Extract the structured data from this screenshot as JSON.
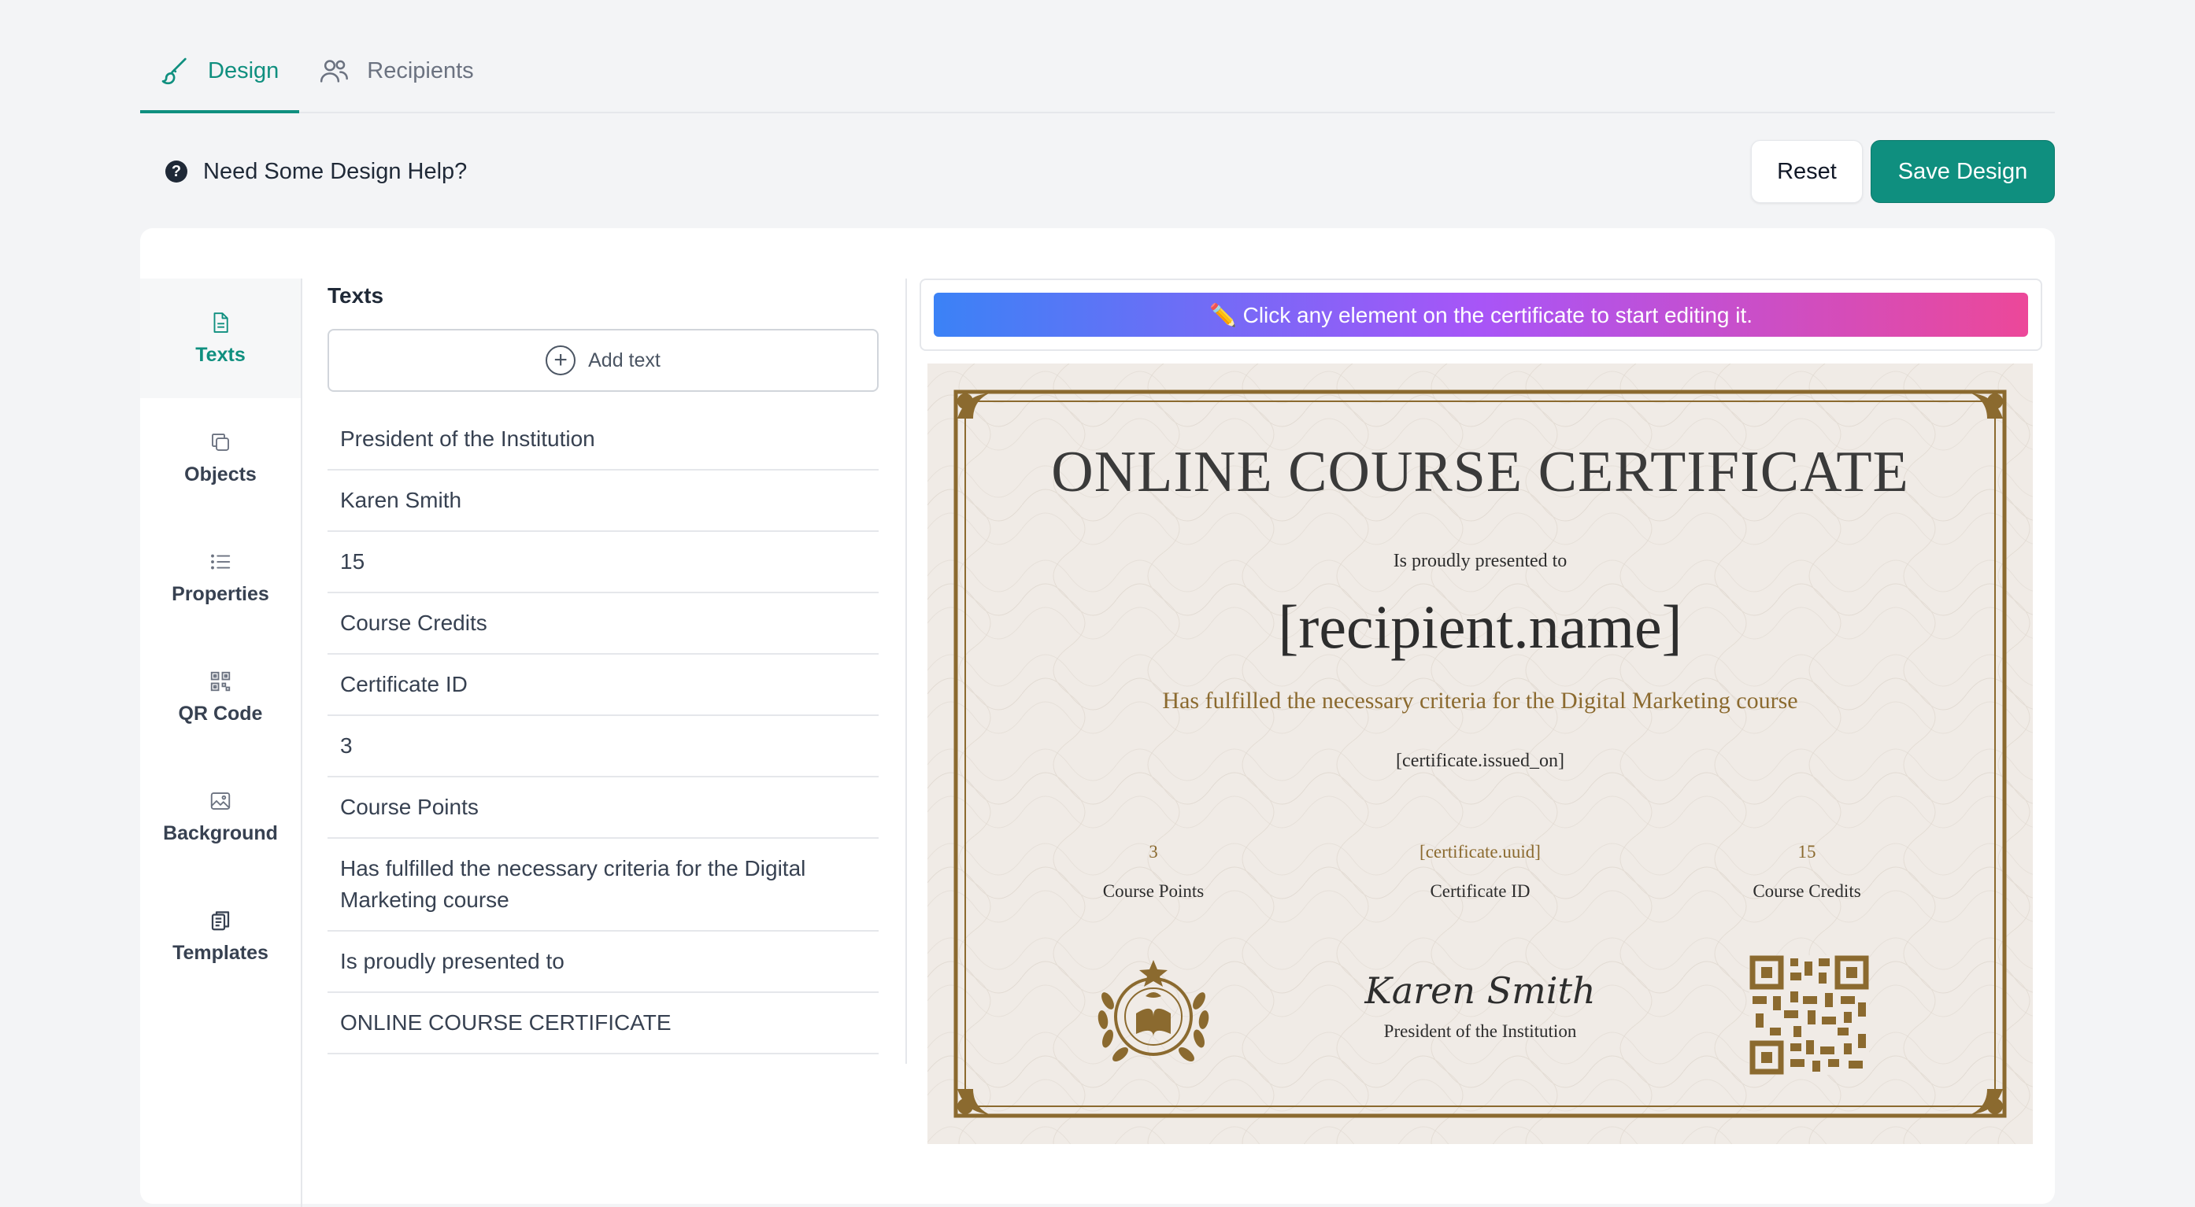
{
  "tabs": [
    {
      "label": "Design",
      "icon": "brush-icon",
      "active": true
    },
    {
      "label": "Recipients",
      "icon": "users-icon",
      "active": false
    }
  ],
  "help": {
    "icon": "question-circle-icon",
    "label": "Need Some Design Help?"
  },
  "actions": {
    "reset_label": "Reset",
    "save_label": "Save Design"
  },
  "sidebar": {
    "items": [
      {
        "label": "Texts",
        "icon": "document-icon",
        "active": true
      },
      {
        "label": "Objects",
        "icon": "copy-icon",
        "active": false
      },
      {
        "label": "Properties",
        "icon": "list-icon",
        "active": false
      },
      {
        "label": "QR Code",
        "icon": "qr-code-icon",
        "active": false
      },
      {
        "label": "Background",
        "icon": "image-icon",
        "active": false
      },
      {
        "label": "Templates",
        "icon": "clipboard-icon",
        "active": false
      }
    ]
  },
  "panel": {
    "title": "Texts",
    "add_label": "Add text",
    "items": [
      "President of the Institution",
      "Karen Smith",
      "15",
      "Course Credits",
      "Certificate ID",
      "3",
      "Course Points",
      "Has fulfilled the necessary criteria for the Digital Marketing course",
      "Is proudly presented to",
      "ONLINE COURSE CERTIFICATE"
    ]
  },
  "preview": {
    "hint": "✏️ Click any element on the certificate to start editing it.",
    "certificate": {
      "title": "ONLINE COURSE CERTIFICATE",
      "subtitle": "Is proudly presented to",
      "recipient": "[recipient.name]",
      "criteria": "Has fulfilled the necessary criteria for the Digital Marketing course",
      "date": "[certificate.issued_on]",
      "stats": [
        {
          "value": "3",
          "label": "Course Points"
        },
        {
          "value": "[certificate.uuid]",
          "label": "Certificate ID"
        },
        {
          "value": "15",
          "label": "Course Credits"
        }
      ],
      "signature": {
        "name": "Karen Smith",
        "title": "President of the Institution"
      },
      "colors": {
        "gold": "#8b6a2f",
        "paper": "#f0ebe6"
      }
    }
  },
  "colors": {
    "accent": "#0f8f7f",
    "background": "#f3f4f6"
  }
}
